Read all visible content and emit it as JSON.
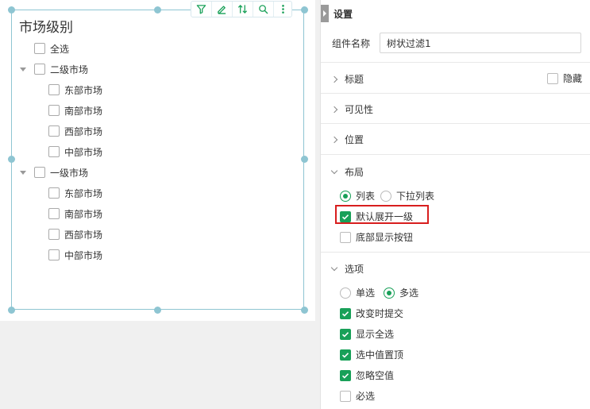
{
  "widget": {
    "title": "市场级别",
    "toolbar": [
      {
        "name": "filter-icon"
      },
      {
        "name": "edit-icon"
      },
      {
        "name": "sort-icon"
      },
      {
        "name": "search-icon"
      },
      {
        "name": "more-icon"
      }
    ],
    "select_all": "全选",
    "groups": [
      {
        "label": "二级市场",
        "children": [
          "东部市场",
          "南部市场",
          "西部市场",
          "中部市场"
        ]
      },
      {
        "label": "一级市场",
        "children": [
          "东部市场",
          "南部市场",
          "西部市场",
          "中部市场"
        ]
      }
    ]
  },
  "panel": {
    "header": "设置",
    "component_name_label": "组件名称",
    "component_name_value": "树状过滤1",
    "title_section": "标题",
    "hide_label": "隐藏",
    "visibility_section": "可见性",
    "position_section": "位置",
    "layout_section": "布局",
    "layout_list": "列表",
    "layout_dropdown": "下拉列表",
    "expand_first_level": "默认展开一级",
    "bottom_buttons": "底部显示按钮",
    "options_section": "选项",
    "single_select": "单选",
    "multi_select": "多选",
    "submit_on_change": "改变时提交",
    "show_select_all": "显示全选",
    "selected_on_top": "选中值置顶",
    "ignore_null": "忽略空值",
    "required": "必选"
  },
  "colors": {
    "accent": "#18a058",
    "frame": "#8ec5d2",
    "highlight": "#d81e1e"
  }
}
